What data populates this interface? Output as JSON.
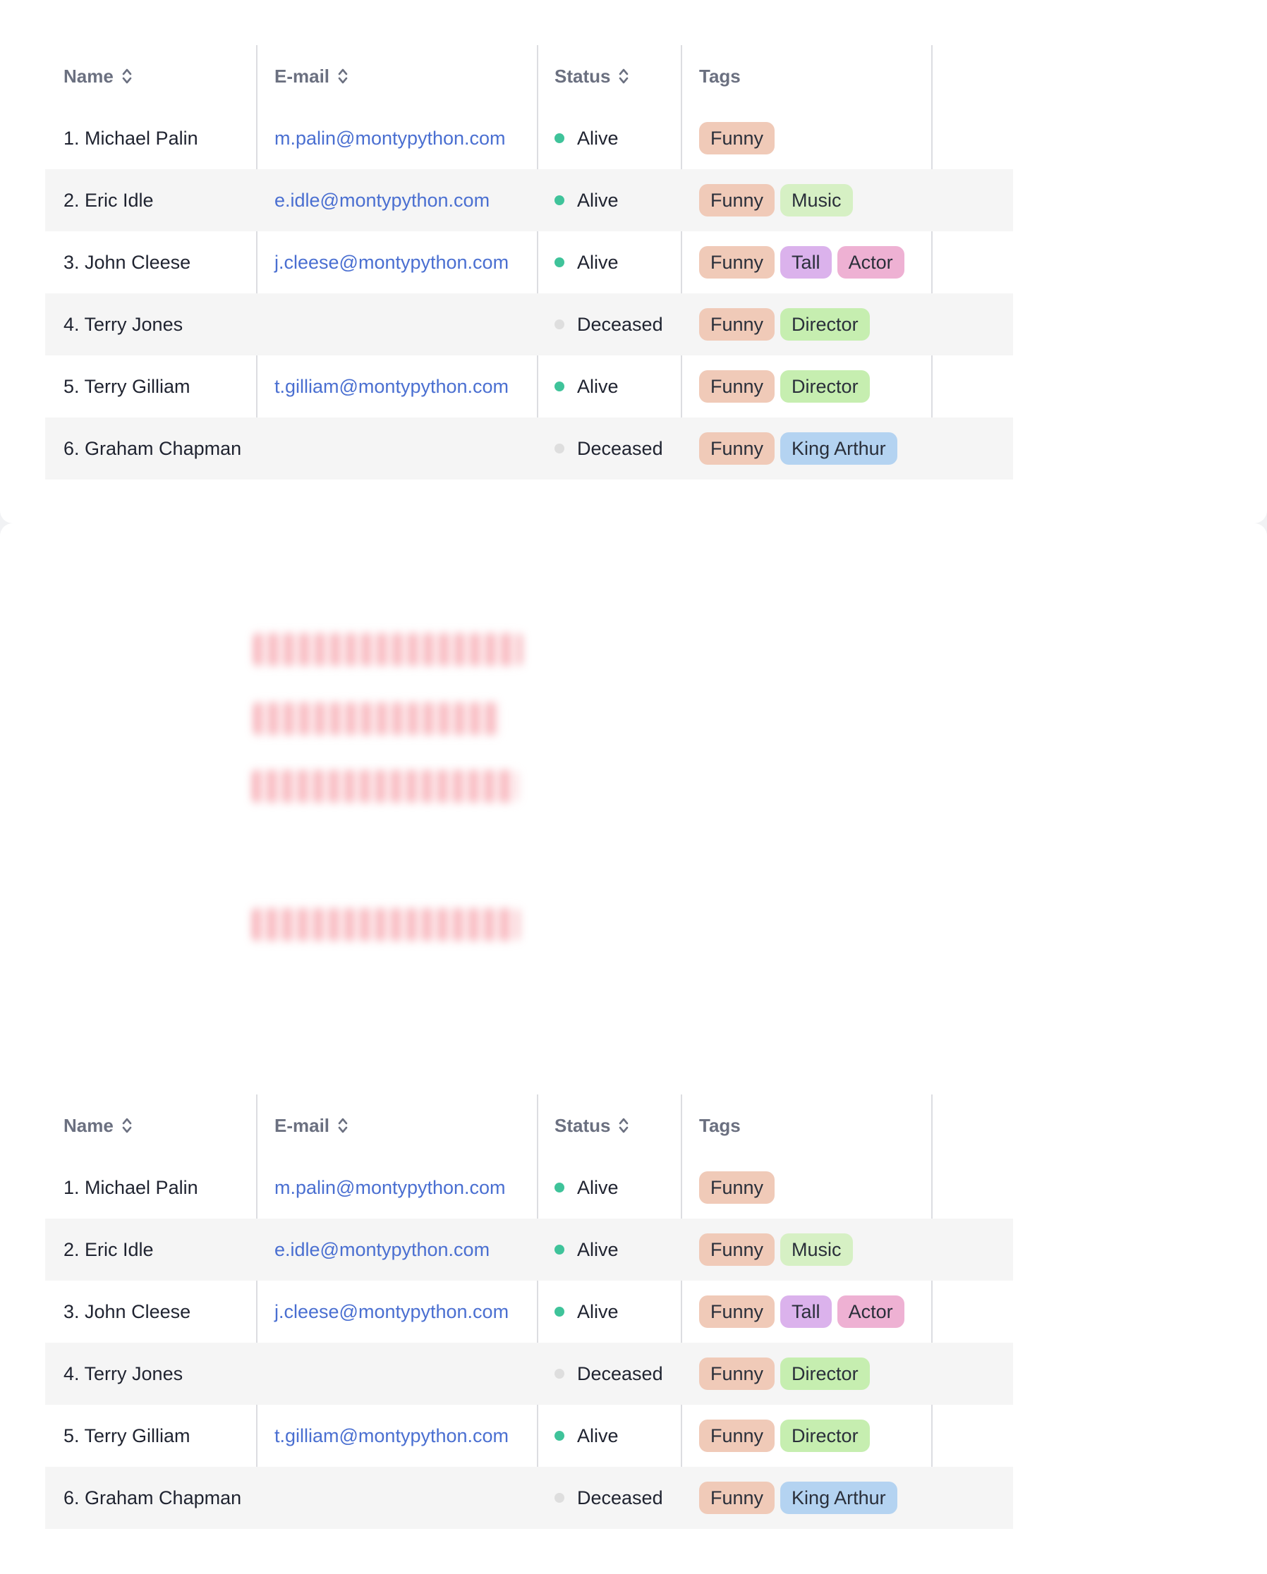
{
  "table": {
    "headers": {
      "name": "Name",
      "email": "E-mail",
      "status": "Status",
      "tags": "Tags"
    },
    "rows": [
      {
        "name": "1. Michael Palin",
        "email": "m.palin@montypython.com",
        "status": "Alive",
        "tags": [
          "Funny"
        ]
      },
      {
        "name": "2. Eric Idle",
        "email": "e.idle@montypython.com",
        "status": "Alive",
        "tags": [
          "Funny",
          "Music"
        ]
      },
      {
        "name": "3. John Cleese",
        "email": "j.cleese@montypython.com",
        "status": "Alive",
        "tags": [
          "Funny",
          "Tall",
          "Actor"
        ]
      },
      {
        "name": "4. Terry Jones",
        "email": "",
        "status": "Deceased",
        "tags": [
          "Funny",
          "Director"
        ]
      },
      {
        "name": "5. Terry Gilliam",
        "email": "t.gilliam@montypython.com",
        "status": "Alive",
        "tags": [
          "Funny",
          "Director"
        ]
      },
      {
        "name": "6. Graham Chapman",
        "email": "",
        "status": "Deceased",
        "tags": [
          "Funny",
          "King Arthur"
        ]
      }
    ]
  },
  "colors": {
    "alive_dot": "#3fc39a",
    "deceased_dot": "#dedede",
    "email_link": "#4a6fd1",
    "tag_funny": "#f0cab8",
    "tag_music": "#d6f0c4",
    "tag_tall": "#dbb2ec",
    "tag_actor": "#eeb1d3",
    "tag_director": "#c6eeb0",
    "tag_king_arthur": "#b4d3f1"
  },
  "icons": {
    "sort": "sort-updown-icon"
  }
}
